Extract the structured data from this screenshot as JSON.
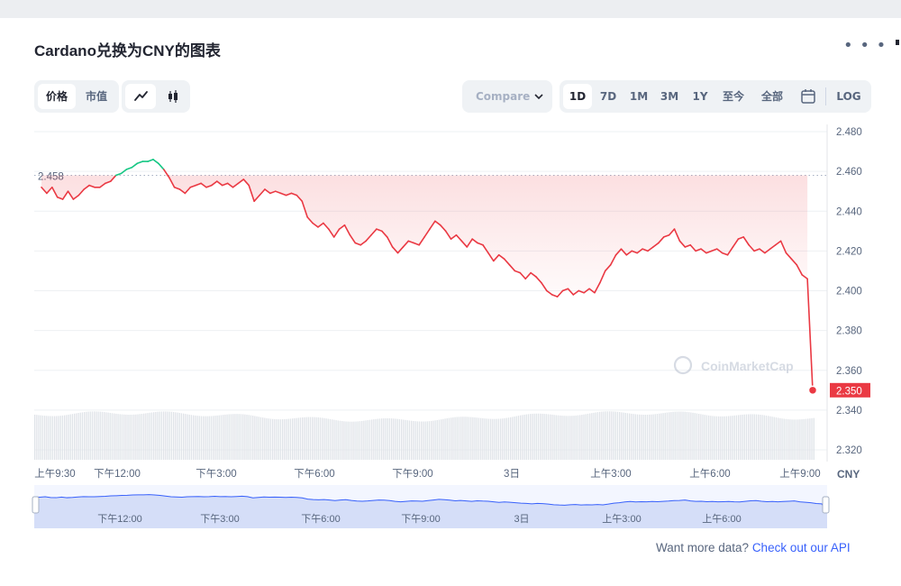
{
  "header": {
    "title": "Cardano兑换为CNY的图表"
  },
  "toolbar": {
    "mode_tabs": [
      "价格",
      "市值"
    ],
    "compare_label": "Compare",
    "range_tabs": [
      "1D",
      "7D",
      "1M",
      "3M",
      "1Y",
      "至今",
      "全部"
    ],
    "log_label": "LOG"
  },
  "chart_data": {
    "type": "line",
    "currency": "CNY",
    "ylim": [
      2.31,
      2.485
    ],
    "y_ticks": [
      "2.480",
      "2.460",
      "2.440",
      "2.420",
      "2.400",
      "2.380",
      "2.360",
      "2.340",
      "2.320"
    ],
    "x_ticks": [
      "上午9:30",
      "下午12:00",
      "下午3:00",
      "下午6:00",
      "下午9:00",
      "3日",
      "上午3:00",
      "上午6:00",
      "上午9:00"
    ],
    "navigator_ticks": [
      "下午12:00",
      "下午3:00",
      "下午6:00",
      "下午9:00",
      "3日",
      "上午3:00",
      "上午6:00"
    ],
    "reference_value": 2.458,
    "reference_label": "2.458",
    "current_label": "2.350",
    "watermark": "CoinMarketCap",
    "series": [
      {
        "values": [
          2.452,
          2.449,
          2.452,
          2.447,
          2.446,
          2.45,
          2.446,
          2.448,
          2.451,
          2.453,
          2.452,
          2.452,
          2.454,
          2.455,
          2.458,
          2.459,
          2.461,
          2.462,
          2.464,
          2.465,
          2.465,
          2.466,
          2.464,
          2.461,
          2.457,
          2.452,
          2.451,
          2.449,
          2.452,
          2.453,
          2.454,
          2.452,
          2.453,
          2.455,
          2.453,
          2.454,
          2.452,
          2.454,
          2.456,
          2.453,
          2.445,
          2.448,
          2.451,
          2.449,
          2.45,
          2.449,
          2.448,
          2.449,
          2.448,
          2.445,
          2.437,
          2.434,
          2.432,
          2.434,
          2.431,
          2.427,
          2.431,
          2.433,
          2.428,
          2.424,
          2.423,
          2.425,
          2.428,
          2.431,
          2.43,
          2.427,
          2.422,
          2.419,
          2.422,
          2.425,
          2.424,
          2.423,
          2.427,
          2.431,
          2.435,
          2.433,
          2.43,
          2.426,
          2.428,
          2.425,
          2.422,
          2.426,
          2.424,
          2.423,
          2.419,
          2.415,
          2.418,
          2.416,
          2.413,
          2.41,
          2.409,
          2.406,
          2.409,
          2.407,
          2.404,
          2.4,
          2.398,
          2.397,
          2.4,
          2.401,
          2.398,
          2.4,
          2.399,
          2.401,
          2.399,
          2.404,
          2.41,
          2.413,
          2.418,
          2.421,
          2.418,
          2.42,
          2.419,
          2.421,
          2.42,
          2.422,
          2.424,
          2.427,
          2.428,
          2.431,
          2.425,
          2.422,
          2.423,
          2.42,
          2.421,
          2.419,
          2.42,
          2.421,
          2.419,
          2.418,
          2.422,
          2.426,
          2.427,
          2.423,
          2.42,
          2.421,
          2.419,
          2.421,
          2.423,
          2.425,
          2.419,
          2.416,
          2.413,
          2.408,
          2.406,
          2.35
        ]
      }
    ]
  },
  "footer": {
    "text": "Want more data? ",
    "link": "Check out our API"
  },
  "colors": {
    "up": "#16c784",
    "down": "#ea3943",
    "nav": "#3861fb",
    "link": "#3861fb"
  }
}
